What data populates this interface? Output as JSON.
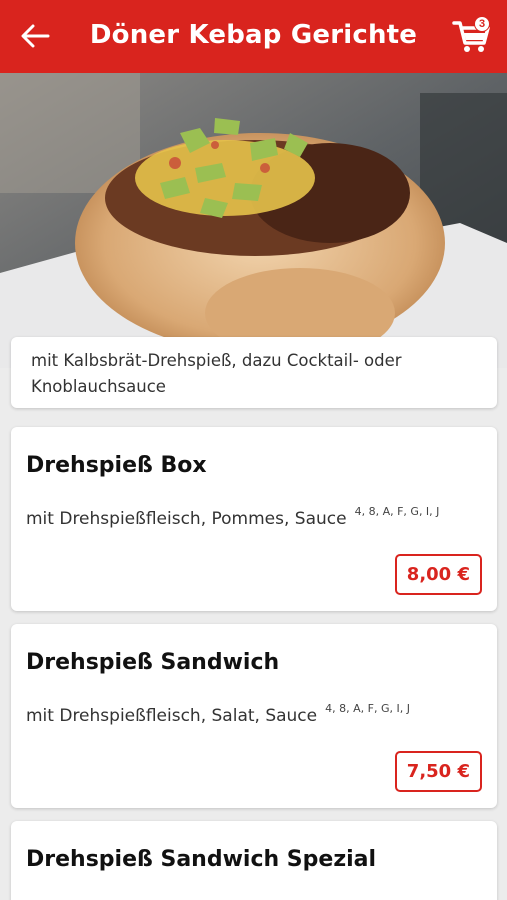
{
  "header": {
    "title": "Döner Kebap Gerichte",
    "cart_count": "3",
    "back_icon": "arrow-left-icon",
    "cart_icon": "shopping-cart-icon",
    "background": "#d9241e"
  },
  "category": {
    "description": "mit Kalbsbrät-Drehspieß, dazu Cocktail- oder Knoblauchsauce"
  },
  "items": [
    {
      "name": "Drehspieß Box",
      "description": "mit Drehspießfleisch, Pommes, Sauce",
      "allergens": "4, 8, A, F, G, I, J",
      "price": "8,00 €"
    },
    {
      "name": "Drehspieß Sandwich",
      "description": "mit Drehspießfleisch, Salat, Sauce",
      "allergens": "4, 8, A, F, G, I, J",
      "price": "7,50 €"
    },
    {
      "name": "Drehspieß Sandwich Spezial"
    }
  ]
}
